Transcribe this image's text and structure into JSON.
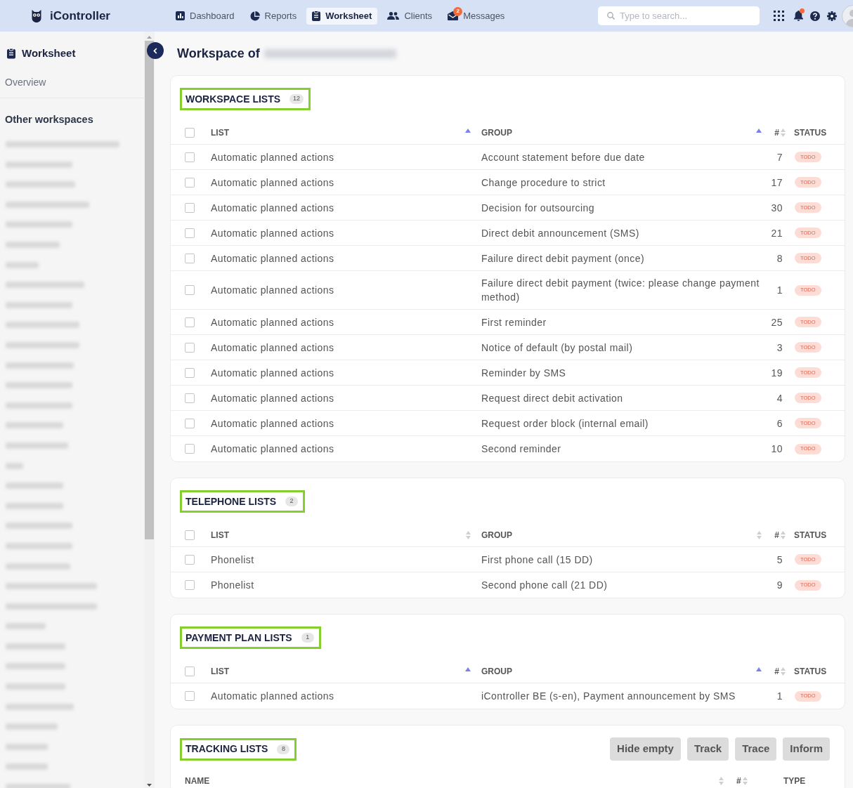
{
  "nav": {
    "logo": "iController",
    "items": [
      {
        "label": "Dashboard",
        "selected": false
      },
      {
        "label": "Reports",
        "selected": false
      },
      {
        "label": "Worksheet",
        "selected": true
      },
      {
        "label": "Clients",
        "selected": false
      },
      {
        "label": "Messages",
        "selected": false,
        "badge": "2"
      }
    ],
    "search": {
      "placeholder": "Type to search..."
    },
    "notifications": {
      "unread": true
    }
  },
  "sidebar": {
    "title": "Worksheet",
    "items": [
      {
        "label": "Overview",
        "selected": false
      }
    ],
    "section_title": "Other workspaces"
  },
  "page": {
    "title": "Workspace of"
  },
  "sections": [
    {
      "kind": "lists",
      "title": "WORKSPACE LISTS",
      "count": "12",
      "highlighted": true,
      "select_all": {
        "checked": false
      },
      "columns": [
        {
          "label": "LIST",
          "sorted": true
        },
        {
          "label": "GROUP",
          "sorted": true
        },
        {
          "label": "#",
          "sorted": false
        },
        {
          "label": "STATUS"
        }
      ],
      "rows": [
        {
          "checked": false,
          "list": "Automatic planned actions",
          "group": "Account statement before due date",
          "count": "7",
          "status": "TODO"
        },
        {
          "checked": false,
          "list": "Automatic planned actions",
          "group": "Change procedure to strict",
          "count": "17",
          "status": "TODO"
        },
        {
          "checked": false,
          "list": "Automatic planned actions",
          "group": "Decision for outsourcing",
          "count": "30",
          "status": "TODO"
        },
        {
          "checked": false,
          "list": "Automatic planned actions",
          "group": "Direct debit announcement (SMS)",
          "count": "21",
          "status": "TODO"
        },
        {
          "checked": false,
          "list": "Automatic planned actions",
          "group": "Failure direct debit payment (once)",
          "count": "8",
          "status": "TODO"
        },
        {
          "checked": false,
          "list": "Automatic planned actions",
          "group": "Failure direct debit payment (twice: please change payment method)",
          "count": "1",
          "status": "TODO"
        },
        {
          "checked": false,
          "list": "Automatic planned actions",
          "group": "First reminder",
          "count": "25",
          "status": "TODO"
        },
        {
          "checked": false,
          "list": "Automatic planned actions",
          "group": "Notice of default (by postal mail)",
          "count": "3",
          "status": "TODO"
        },
        {
          "checked": false,
          "list": "Automatic planned actions",
          "group": "Reminder by SMS",
          "count": "19",
          "status": "TODO"
        },
        {
          "checked": false,
          "list": "Automatic planned actions",
          "group": "Request direct debit activation",
          "count": "4",
          "status": "TODO"
        },
        {
          "checked": false,
          "list": "Automatic planned actions",
          "group": "Request order block (internal email)",
          "count": "6",
          "status": "TODO"
        },
        {
          "checked": false,
          "list": "Automatic planned actions",
          "group": "Second reminder",
          "count": "10",
          "status": "TODO"
        }
      ]
    },
    {
      "kind": "lists",
      "title": "TELEPHONE LISTS",
      "count": "2",
      "highlighted": true,
      "select_all": {
        "checked": false
      },
      "columns": [
        {
          "label": "LIST",
          "sorted": false
        },
        {
          "label": "GROUP",
          "sorted": false
        },
        {
          "label": "#",
          "sorted": false
        },
        {
          "label": "STATUS"
        }
      ],
      "rows": [
        {
          "checked": false,
          "list": "Phonelist",
          "group": "First phone call (15 DD)",
          "count": "5",
          "status": "TODO"
        },
        {
          "checked": false,
          "list": "Phonelist",
          "group": "Second phone call (21 DD)",
          "count": "9",
          "status": "TODO"
        }
      ]
    },
    {
      "kind": "lists",
      "title": "PAYMENT PLAN LISTS",
      "count": "1",
      "highlighted": true,
      "select_all": {
        "checked": false
      },
      "columns": [
        {
          "label": "LIST",
          "sorted": true
        },
        {
          "label": "GROUP",
          "sorted": true
        },
        {
          "label": "#",
          "sorted": false
        },
        {
          "label": "STATUS"
        }
      ],
      "rows": [
        {
          "checked": false,
          "list": "Automatic planned actions",
          "group": "iController BE (s-en), Payment announcement by SMS",
          "count": "1",
          "status": "TODO"
        }
      ]
    },
    {
      "kind": "tracking",
      "title": "TRACKING LISTS",
      "count": "8",
      "highlighted": true,
      "buttons": [
        "Hide empty",
        "Track",
        "Trace",
        "Inform"
      ],
      "columns": [
        {
          "label": "NAME",
          "sorted": false
        },
        {
          "label": "#",
          "sorted": false
        },
        {
          "label": "TYPE"
        }
      ]
    }
  ]
}
